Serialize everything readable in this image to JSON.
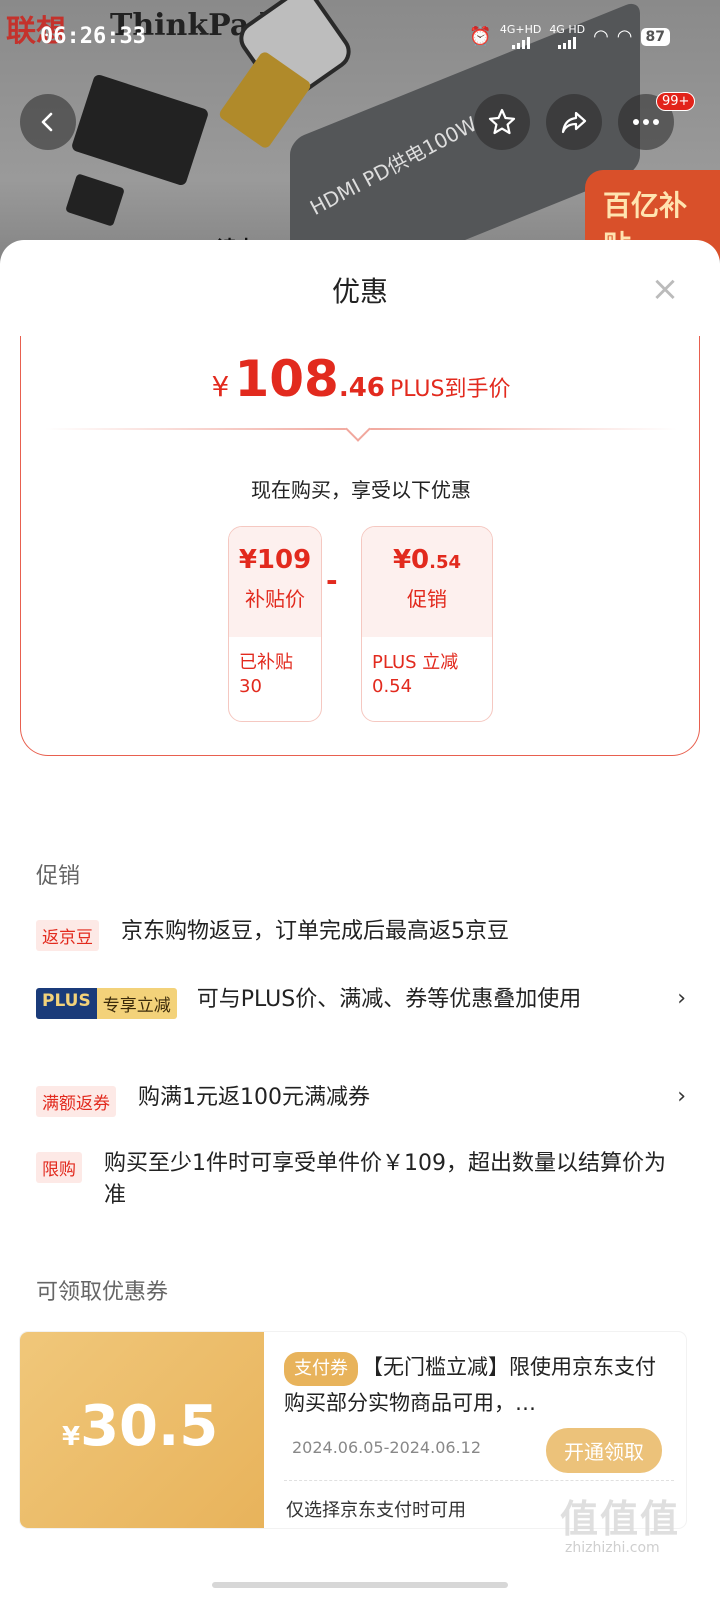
{
  "status_bar": {
    "time": "06:26:33",
    "signal1": "4G+HD",
    "signal2": "4G HD",
    "battery": "87"
  },
  "background": {
    "brand_cn": "联想",
    "brand_en": "ThinkPad",
    "hub_text": "HDMI PD供电100W",
    "reader_text": "D读卡",
    "badge_text": "百亿补贴"
  },
  "top_buttons": {
    "more_badge": "99+"
  },
  "sheet": {
    "title": "优惠",
    "price": {
      "currency": "¥",
      "integer": "108",
      "decimal": ".46",
      "label": "PLUS到手价"
    },
    "benefit_title": "现在购买，享受以下优惠",
    "minus_sign": "-",
    "boxes": [
      {
        "amount": "¥109",
        "name": "补贴价",
        "detail_line1": "已补贴",
        "detail_line2": "30"
      },
      {
        "amount_int": "¥0",
        "amount_dec": ".54",
        "name": "促销",
        "detail_line1": "PLUS 立减",
        "detail_line2": "0.54"
      }
    ]
  },
  "promo": {
    "section_title": "促销",
    "items": [
      {
        "tag": "返京豆",
        "text": "京东购物返豆，订单完成后最高返5京豆",
        "arrow": false
      },
      {
        "tag_a": "PLUS",
        "tag_b": "专享立减",
        "text": "可与PLUS价、满减、券等优惠叠加使用",
        "arrow": true
      },
      {
        "tag": "满额返券",
        "text": "购满1元返100元满减券",
        "arrow": true
      },
      {
        "tag": "限购",
        "text": "购买至少1件时可享受单件价￥109，超出数量以结算价为准",
        "arrow": false
      }
    ],
    "chevron": "›"
  },
  "coupons": {
    "section_title": "可领取优惠券",
    "items": [
      {
        "currency": "¥",
        "value": "30.5",
        "tag": "支付券",
        "text": "【无门槛立减】限使用京东支付购买部分实物商品可用，…",
        "date": "2024.06.05-2024.06.12",
        "button": "开通领取",
        "note": "仅选择京东支付时可用"
      }
    ]
  },
  "watermark": {
    "text": "值值值",
    "sub": "zhizhizhi.com"
  },
  "colors": {
    "accent_red": "#e22a1e",
    "coupon_gold": "#e8b35b",
    "plus_blue": "#1a3b7a"
  }
}
